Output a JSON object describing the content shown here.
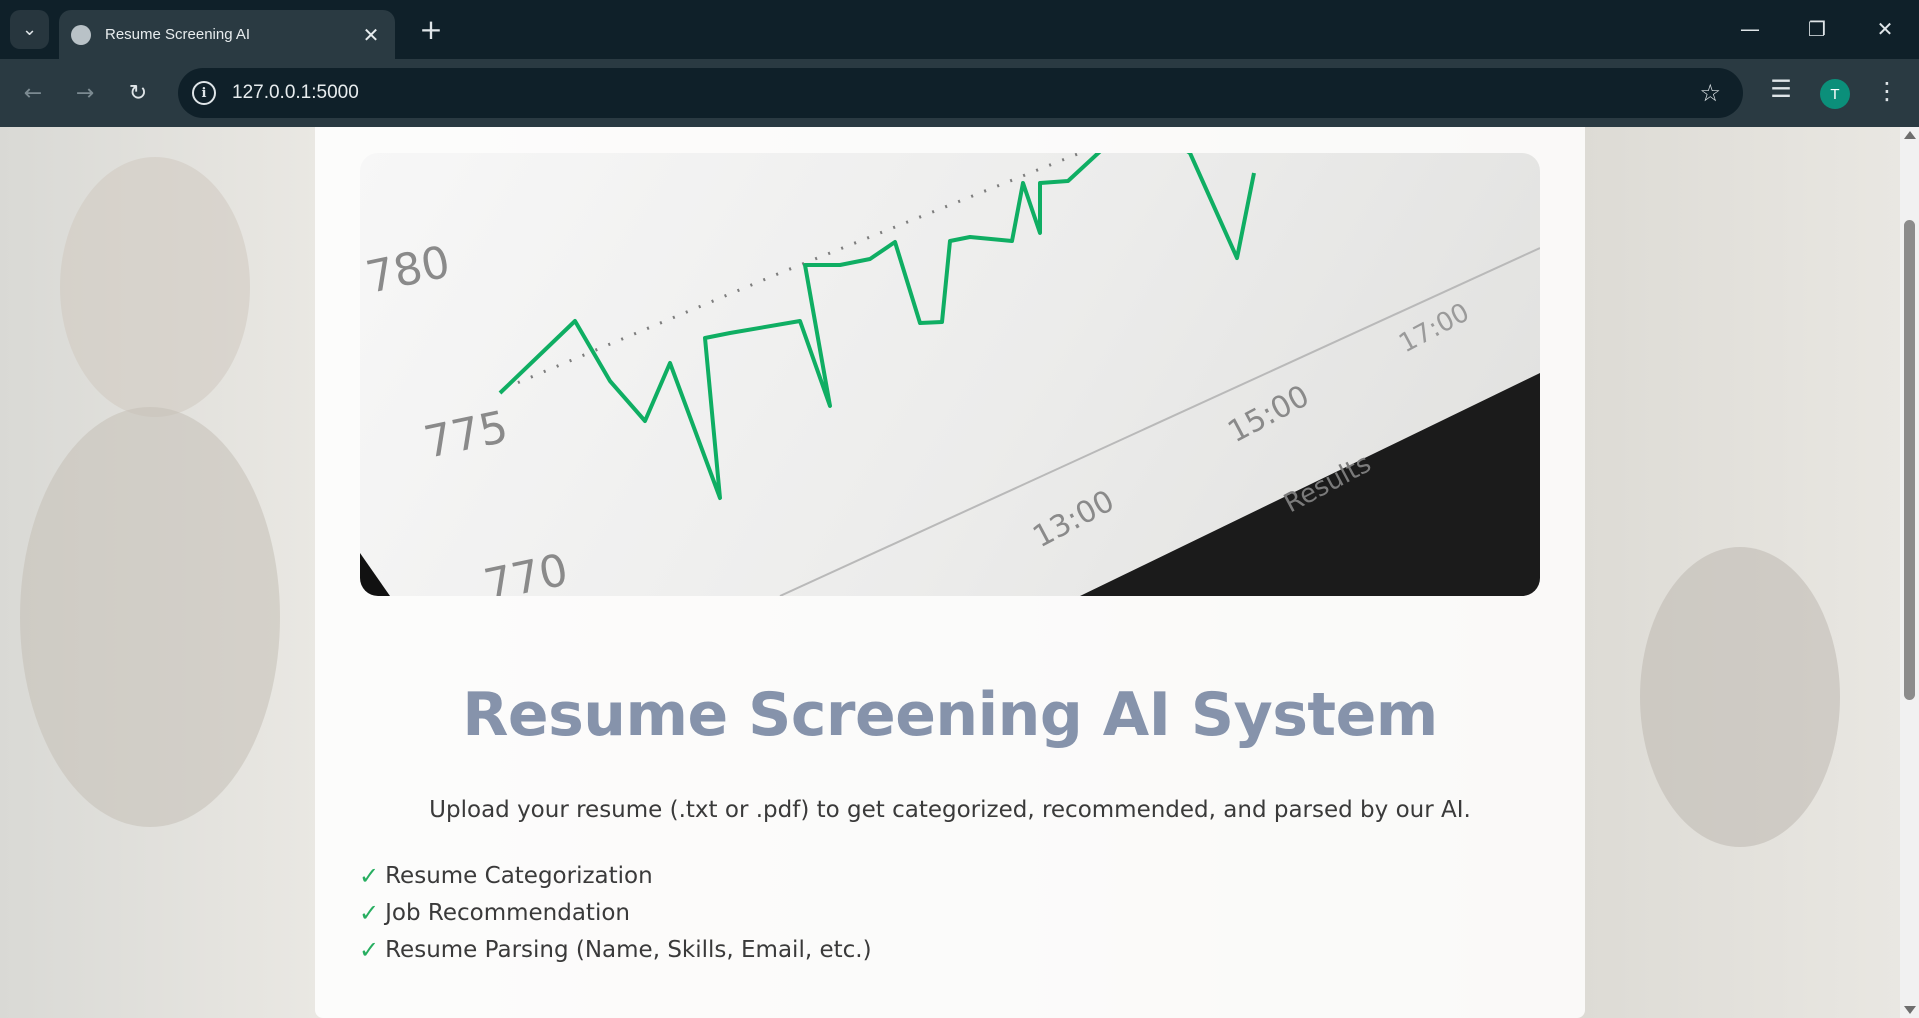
{
  "browser": {
    "tab_title": "Resume Screening AI",
    "url": "127.0.0.1:5000",
    "profile_initial": "T"
  },
  "page": {
    "title": "Resume Screening AI System",
    "subtitle": "Upload your resume (.txt or .pdf) to get categorized, recommended, and parsed by our AI.",
    "features": [
      "Resume Categorization",
      "Job Recommendation",
      "Resume Parsing (Name, Skills, Email, etc.)"
    ],
    "check_mark": "✓",
    "hero_image": {
      "price_labels": [
        "780",
        "775",
        "770"
      ],
      "time_labels": [
        "13:00",
        "15:00",
        "17:00"
      ],
      "footer_label": "Results",
      "line_color": "#0fae63"
    }
  },
  "colors": {
    "title": "#8693ab",
    "check": "#27ae60",
    "chrome_dark": "#0f2029",
    "chrome_mid": "#2a3a42"
  }
}
